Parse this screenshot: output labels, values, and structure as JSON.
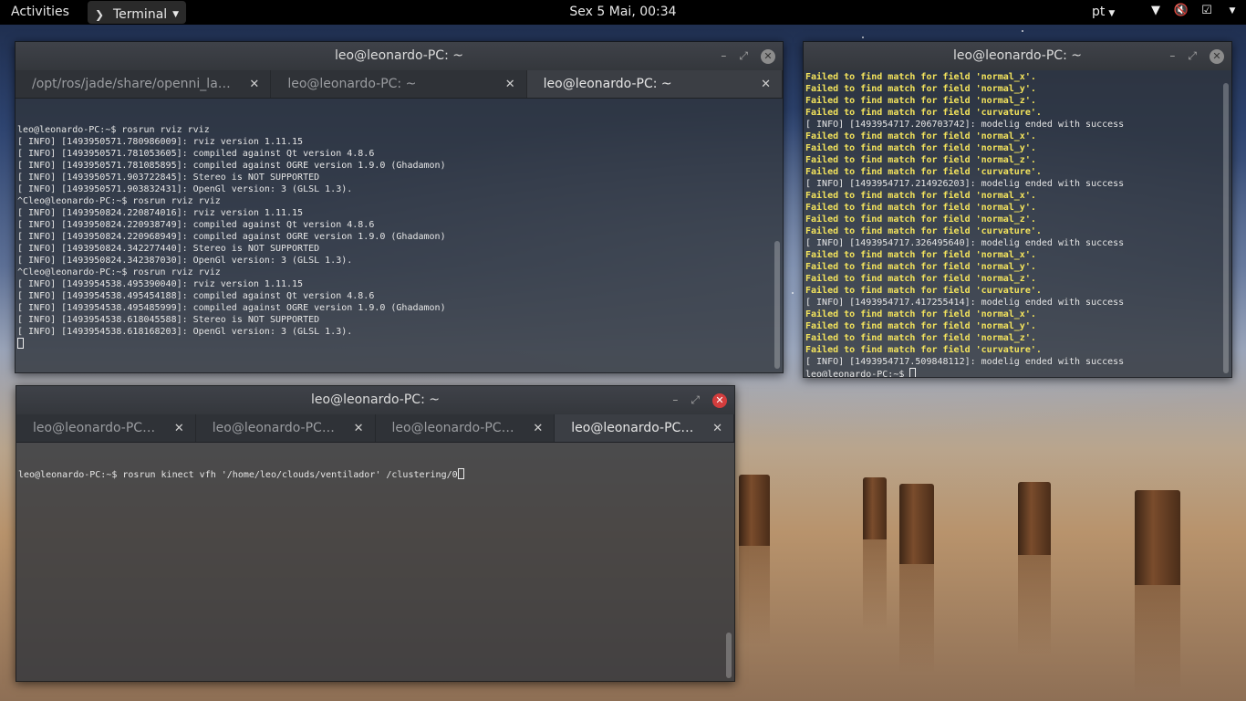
{
  "topbar": {
    "activities": "Activities",
    "app_menu": "Terminal",
    "clock": "Sex  5 Mai, 00:34",
    "language": "pt",
    "icons": [
      "network-wifi-icon",
      "volume-muted-icon",
      "clipboard-check-icon",
      "menu-caret-icon"
    ]
  },
  "win1": {
    "title": "leo@leonardo-PC: ~",
    "tabs": [
      {
        "label": "/opt/ros/jade/share/openni_launc…"
      },
      {
        "label": "leo@leonardo-PC: ~"
      },
      {
        "label": "leo@leonardo-PC: ~"
      }
    ],
    "lines": [
      "leo@leonardo-PC:~$ rosrun rviz rviz",
      "[ INFO] [1493950571.780986009]: rviz version 1.11.15",
      "[ INFO] [1493950571.781053605]: compiled against Qt version 4.8.6",
      "[ INFO] [1493950571.781085895]: compiled against OGRE version 1.9.0 (Ghadamon)",
      "[ INFO] [1493950571.903722845]: Stereo is NOT SUPPORTED",
      "[ INFO] [1493950571.903832431]: OpenGl version: 3 (GLSL 1.3).",
      "^Cleo@leonardo-PC:~$ rosrun rviz rviz",
      "[ INFO] [1493950824.220874016]: rviz version 1.11.15",
      "[ INFO] [1493950824.220938749]: compiled against Qt version 4.8.6",
      "[ INFO] [1493950824.220968949]: compiled against OGRE version 1.9.0 (Ghadamon)",
      "[ INFO] [1493950824.342277440]: Stereo is NOT SUPPORTED",
      "[ INFO] [1493950824.342387030]: OpenGl version: 3 (GLSL 1.3).",
      "^Cleo@leonardo-PC:~$ rosrun rviz rviz",
      "[ INFO] [1493954538.495390040]: rviz version 1.11.15",
      "[ INFO] [1493954538.495454188]: compiled against Qt version 4.8.6",
      "[ INFO] [1493954538.495485999]: compiled against OGRE version 1.9.0 (Ghadamon)",
      "[ INFO] [1493954538.618045588]: Stereo is NOT SUPPORTED",
      "[ INFO] [1493954538.618168203]: OpenGl version: 3 (GLSL 1.3)."
    ]
  },
  "win2": {
    "title": "leo@leonardo-PC: ~",
    "lines": [
      {
        "t": "Failed to find match for field 'normal_x'.",
        "y": true
      },
      {
        "t": "Failed to find match for field 'normal_y'.",
        "y": true
      },
      {
        "t": "Failed to find match for field 'normal_z'.",
        "y": true
      },
      {
        "t": "Failed to find match for field 'curvature'.",
        "y": true
      },
      {
        "t": "[ INFO] [1493954717.206703742]: modelig ended with success",
        "y": false
      },
      {
        "t": "Failed to find match for field 'normal_x'.",
        "y": true
      },
      {
        "t": "Failed to find match for field 'normal_y'.",
        "y": true
      },
      {
        "t": "Failed to find match for field 'normal_z'.",
        "y": true
      },
      {
        "t": "Failed to find match for field 'curvature'.",
        "y": true
      },
      {
        "t": "[ INFO] [1493954717.214926203]: modelig ended with success",
        "y": false
      },
      {
        "t": "Failed to find match for field 'normal_x'.",
        "y": true
      },
      {
        "t": "Failed to find match for field 'normal_y'.",
        "y": true
      },
      {
        "t": "Failed to find match for field 'normal_z'.",
        "y": true
      },
      {
        "t": "Failed to find match for field 'curvature'.",
        "y": true
      },
      {
        "t": "[ INFO] [1493954717.326495640]: modelig ended with success",
        "y": false
      },
      {
        "t": "Failed to find match for field 'normal_x'.",
        "y": true
      },
      {
        "t": "Failed to find match for field 'normal_y'.",
        "y": true
      },
      {
        "t": "Failed to find match for field 'normal_z'.",
        "y": true
      },
      {
        "t": "Failed to find match for field 'curvature'.",
        "y": true
      },
      {
        "t": "[ INFO] [1493954717.417255414]: modelig ended with success",
        "y": false
      },
      {
        "t": "Failed to find match for field 'normal_x'.",
        "y": true
      },
      {
        "t": "Failed to find match for field 'normal_y'.",
        "y": true
      },
      {
        "t": "Failed to find match for field 'normal_z'.",
        "y": true
      },
      {
        "t": "Failed to find match for field 'curvature'.",
        "y": true
      },
      {
        "t": "[ INFO] [1493954717.509848112]: modelig ended with success",
        "y": false
      }
    ],
    "prompt": "leo@leonardo-PC:~$ "
  },
  "win3": {
    "title": "leo@leonardo-PC: ~",
    "tabs": [
      {
        "label": "leo@leonardo-PC: ~"
      },
      {
        "label": "leo@leonardo-PC: ~"
      },
      {
        "label": "leo@leonardo-PC: ~"
      },
      {
        "label": "leo@leonardo-PC: ~"
      }
    ],
    "command": "leo@leonardo-PC:~$ rosrun kinect vfh '/home/leo/clouds/ventilador' /clustering/0"
  }
}
